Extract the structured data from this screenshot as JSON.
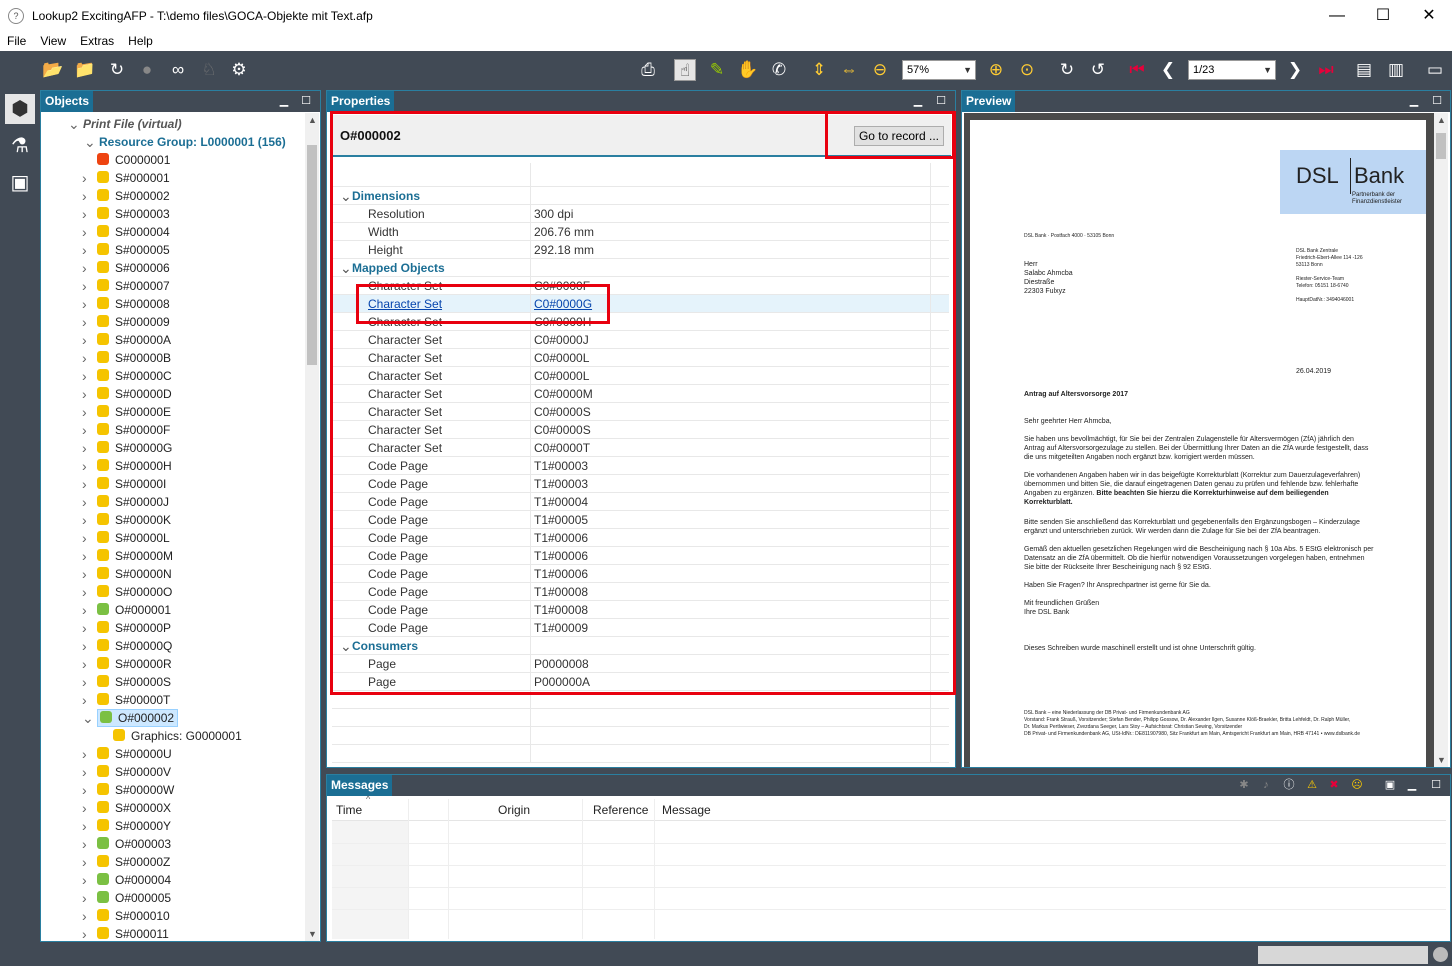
{
  "window": {
    "title": "Lookup2 ExcitingAFP - T:\\demo files\\GOCA-Objekte mit Text.afp",
    "minimize": "—",
    "maximize": "☐",
    "close": "✕"
  },
  "menu": [
    "File",
    "View",
    "Extras",
    "Help"
  ],
  "toolbar": {
    "zoom": "57%",
    "page": "1/23"
  },
  "objects": {
    "title": "Objects",
    "root": "Print File (virtual)",
    "group": "Resource Group: L0000001 (156)",
    "items": [
      "C0000001",
      "S#000001",
      "S#000002",
      "S#000003",
      "S#000004",
      "S#000005",
      "S#000006",
      "S#000007",
      "S#000008",
      "S#000009",
      "S#00000A",
      "S#00000B",
      "S#00000C",
      "S#00000D",
      "S#00000E",
      "S#00000F",
      "S#00000G",
      "S#00000H",
      "S#00000I",
      "S#00000J",
      "S#00000K",
      "S#00000L",
      "S#00000M",
      "S#00000N",
      "S#00000O",
      "O#000001",
      "S#00000P",
      "S#00000Q",
      "S#00000R",
      "S#00000S",
      "S#00000T",
      "O#000002"
    ],
    "child": "Graphics: G0000001",
    "items2": [
      "S#00000U",
      "S#00000V",
      "S#00000W",
      "S#00000X",
      "S#00000Y",
      "O#000003",
      "S#00000Z",
      "O#000004",
      "O#000005",
      "S#000010",
      "S#000011"
    ]
  },
  "properties": {
    "title": "Properties",
    "header": "O#000002",
    "go_button": "Go to record ...",
    "groups": {
      "dimensions": "Dimensions",
      "mapped": "Mapped Objects",
      "consumers": "Consumers"
    },
    "dimensions": [
      [
        "Resolution",
        "300 dpi"
      ],
      [
        "Width",
        "206.76 mm"
      ],
      [
        "Height",
        "292.18 mm"
      ]
    ],
    "mapped": [
      [
        "Character Set",
        "C0#0000F"
      ],
      [
        "Character Set",
        "C0#0000G"
      ],
      [
        "Character Set",
        "C0#0000H"
      ],
      [
        "Character Set",
        "C0#0000J"
      ],
      [
        "Character Set",
        "C0#0000L"
      ],
      [
        "Character Set",
        "C0#0000L"
      ],
      [
        "Character Set",
        "C0#0000M"
      ],
      [
        "Character Set",
        "C0#0000S"
      ],
      [
        "Character Set",
        "C0#0000S"
      ],
      [
        "Character Set",
        "C0#0000T"
      ],
      [
        "Code Page",
        "T1#00003"
      ],
      [
        "Code Page",
        "T1#00003"
      ],
      [
        "Code Page",
        "T1#00004"
      ],
      [
        "Code Page",
        "T1#00005"
      ],
      [
        "Code Page",
        "T1#00006"
      ],
      [
        "Code Page",
        "T1#00006"
      ],
      [
        "Code Page",
        "T1#00006"
      ],
      [
        "Code Page",
        "T1#00008"
      ],
      [
        "Code Page",
        "T1#00008"
      ],
      [
        "Code Page",
        "T1#00009"
      ]
    ],
    "consumers": [
      [
        "Page",
        "P0000008"
      ],
      [
        "Page",
        "P000000A"
      ]
    ]
  },
  "preview": {
    "title": "Preview",
    "bank1": "DSL",
    "bank2": "Bank",
    "bank_sub1": "Partnerbank der",
    "bank_sub2": "Finanzdienstleister",
    "sender": "DSL Bank · Postfach 4000 · 53105 Bonn",
    "addr": [
      "Herr",
      "Salabc Ahmcba",
      "Diestraße",
      "22303 Fulxyz"
    ],
    "right": [
      "DSL Bank Zentrale",
      "Friedrich-Ebert-Allee 114 -126",
      "53113 Bonn",
      "",
      "Riester-Service-Team",
      "Telefon: 05151 18-6740",
      "",
      "HauptDatNr.: 3494046001"
    ],
    "date": "26.04.2019",
    "subject": "Antrag auf Altersvorsorge 2017",
    "greeting": "Sehr geehrter Herr Ahmcba,",
    "p1": "Sie haben uns bevollmächtigt, für Sie bei der Zentralen Zulagenstelle für Altersvermögen (ZfA) jährlich den Antrag auf Altersvorsorgezulage zu stellen. Bei der Übermittlung Ihrer Daten an die ZfA wurde festgestellt, dass die uns mitgeteilten Angaben noch ergänzt bzw. korrigiert werden müssen.",
    "p2": "Die vorhandenen Angaben haben wir in das beigefügte Korrekturblatt (Korrektur zum Dauerzulageverfahren) übernommen und bitten Sie, die darauf eingetragenen Daten genau zu prüfen und fehlende bzw. fehlerhafte Angaben zu ergänzen.",
    "p2b": "Bitte beachten Sie hierzu die Korrekturhinweise auf dem beiliegenden Korrekturblatt.",
    "p3": "Bitte senden Sie anschließend das Korrekturblatt und gegebenenfalls den Ergänzungsbogen – Kinderzulage ergänzt und unterschrieben zurück. Wir werden dann die Zulage für Sie bei der ZfA beantragen.",
    "p4": "Gemäß den aktuellen gesetzlichen Regelungen wird die Bescheinigung nach § 10a Abs. 5 EStG elektronisch per Datensatz an die ZfA übermittelt. Ob die hierfür notwendigen Voraussetzungen vorgelegen haben, entnehmen Sie bitte der Rückseite Ihrer Bescheinigung nach § 92 EStG.",
    "p5": "Haben Sie Fragen? Ihr Ansprechpartner ist gerne für Sie da.",
    "closing1": "Mit freundlichen Grüßen",
    "closing2": "Ihre DSL Bank",
    "note": "Dieses Schreiben wurde maschinell erstellt und ist ohne Unterschrift gültig.",
    "footer": [
      "DSL Bank – eine Niederlassung der DB Privat- und Firmenkundenbank AG",
      "Vorstand: Frank Strauß, Vorsitzender; Stefan Bender, Philipp Gossow, Dr. Alexander Ilgen, Susanne Klöß-Braekler, Britta Lehfeldt, Dr. Ralph Müller,",
      "Dr. Markus Pertlwieser, Zvezdana Seeger, Lars Stoy – Aufsichtsrat: Christian Sewing, Vorsitzender",
      "DB Privat- und Firmenkundenbank AG, USt-IdNr.: DE811907980, Sitz Frankfurt am Main, Amtsgericht Frankfurt am Main, HRB 47141 • www.dslbank.de"
    ]
  },
  "messages": {
    "title": "Messages",
    "cols": [
      "Time",
      "Origin",
      "Reference",
      "Message"
    ]
  }
}
